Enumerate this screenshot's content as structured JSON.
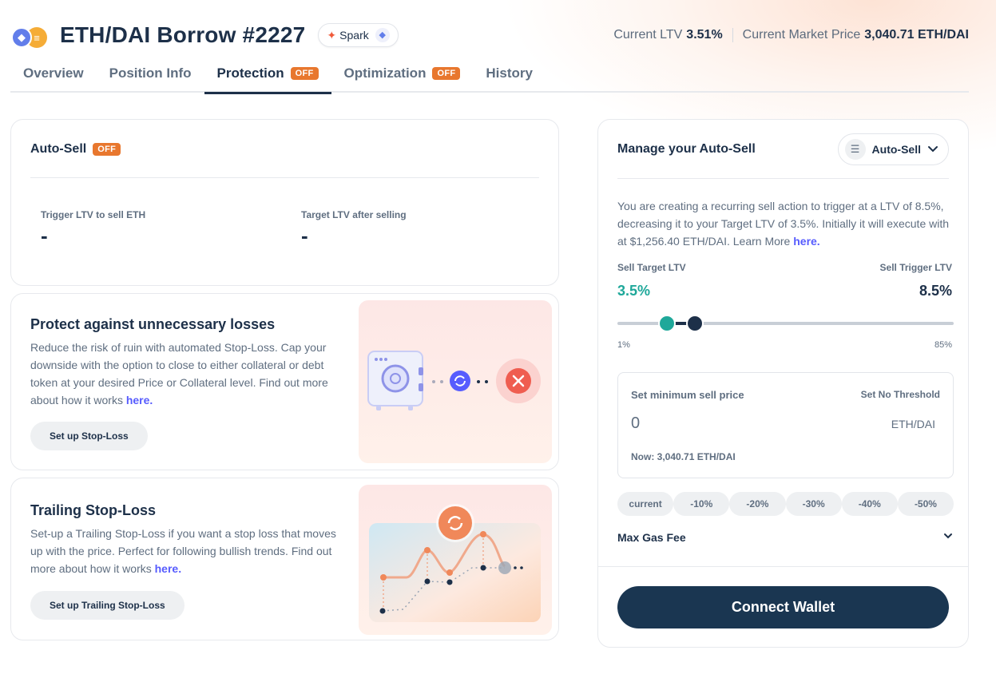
{
  "header": {
    "title": "ETH/DAI Borrow #2227",
    "protocol": "Spark",
    "current_ltv_label": "Current LTV",
    "current_ltv_value": "3.51%",
    "market_price_label": "Current Market Price",
    "market_price_value": "3,040.71 ETH/DAI"
  },
  "tabs": [
    {
      "label": "Overview",
      "badge": null,
      "active": false
    },
    {
      "label": "Position Info",
      "badge": null,
      "active": false
    },
    {
      "label": "Protection",
      "badge": "OFF",
      "active": true
    },
    {
      "label": "Optimization",
      "badge": "OFF",
      "active": false
    },
    {
      "label": "History",
      "badge": null,
      "active": false
    }
  ],
  "autosell": {
    "title": "Auto-Sell",
    "badge": "OFF",
    "trigger_label": "Trigger LTV to sell ETH",
    "trigger_value": "-",
    "target_label": "Target LTV after selling",
    "target_value": "-"
  },
  "stoploss": {
    "title": "Protect against unnecessary losses",
    "text": "Reduce the risk of ruin with automated Stop-Loss. Cap your downside with the option to close to either collateral or debt token at your desired Price or Collateral level. Find out more about how it works",
    "link": "here.",
    "button": "Set up Stop-Loss"
  },
  "trailing": {
    "title": "Trailing Stop-Loss",
    "text": "Set-up a Trailing Stop-Loss if you want a stop loss that moves up with the price. Perfect for following bullish trends. Find out more about how it works",
    "link": "here.",
    "button": "Set up Trailing Stop-Loss"
  },
  "manage": {
    "title": "Manage your Auto-Sell",
    "selector": "Auto-Sell",
    "description": "You are creating a recurring sell action to trigger at a LTV of 8.5%, decreasing it to your Target LTV of 3.5%. Initially it will execute with at $1,256.40 ETH/DAI. Learn More",
    "description_link": "here.",
    "target_label": "Sell Target LTV",
    "target_value": "3.5%",
    "trigger_label": "Sell Trigger LTV",
    "trigger_value": "8.5%",
    "slider": {
      "min": 1,
      "max": 85,
      "target": 3.5,
      "trigger": 8.5
    },
    "range_min": "1%",
    "range_max": "85%",
    "min_price_label": "Set minimum sell price",
    "no_threshold": "Set No Threshold",
    "min_price_value": "0",
    "min_price_unit": "ETH/DAI",
    "now_text": "Now: 3,040.71 ETH/DAI",
    "chips": [
      "current",
      "-10%",
      "-20%",
      "-30%",
      "-40%",
      "-50%"
    ],
    "gas_label": "Max Gas Fee",
    "connect": "Connect Wallet"
  },
  "colors": {
    "accent_teal": "#1fa89a",
    "navy": "#1d3049",
    "off_badge": "#e8772e",
    "link": "#575cfe",
    "connect_bg": "#1a3651"
  },
  "icons": {
    "spark": "spark-star-icon",
    "eth": "ethereum-icon",
    "selector": "sliders-icon",
    "chevron": "chevron-down-icon"
  }
}
